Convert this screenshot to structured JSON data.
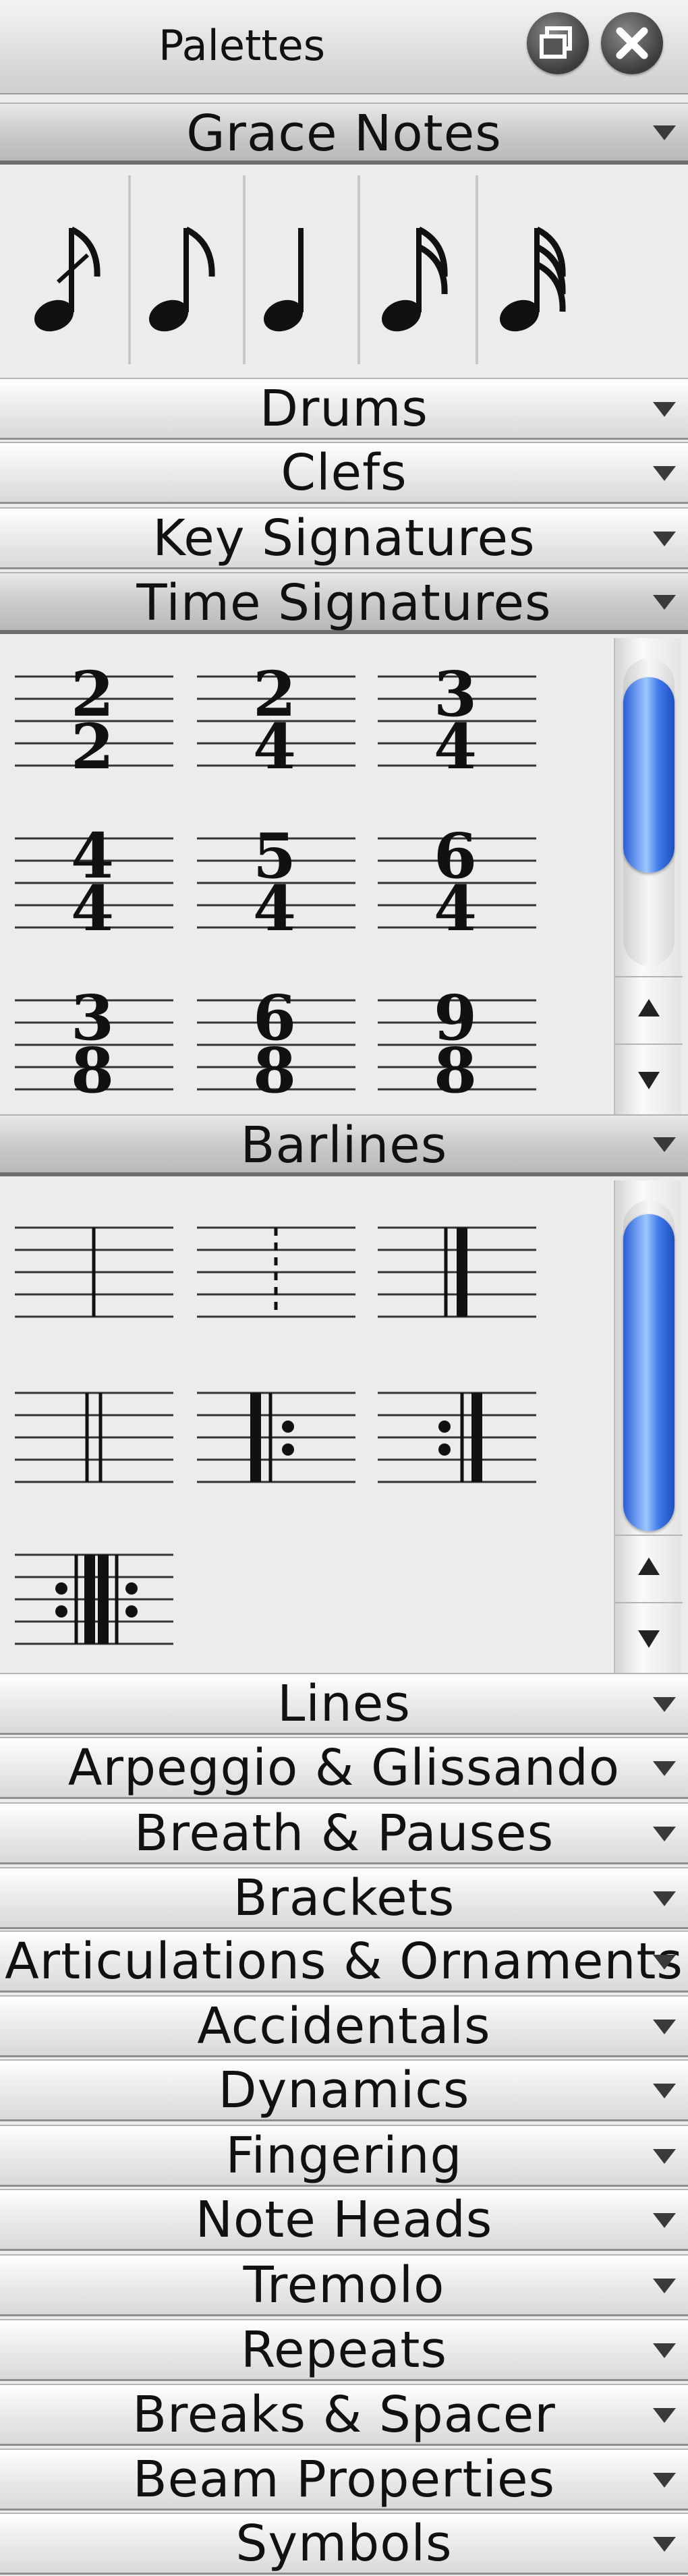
{
  "window": {
    "title": "Palettes",
    "buttons": {
      "restore": "restore-icon",
      "close": "close-icon"
    }
  },
  "sections": [
    {
      "label": "Grace Notes",
      "expanded": true
    },
    {
      "label": "Drums",
      "expanded": false
    },
    {
      "label": "Clefs",
      "expanded": false
    },
    {
      "label": "Key Signatures",
      "expanded": false
    },
    {
      "label": "Time Signatures",
      "expanded": true
    },
    {
      "label": "Barlines",
      "expanded": true
    },
    {
      "label": "Lines",
      "expanded": false
    },
    {
      "label": "Arpeggio & Glissando",
      "expanded": false
    },
    {
      "label": "Breath & Pauses",
      "expanded": false
    },
    {
      "label": "Brackets",
      "expanded": false
    },
    {
      "label": "Articulations & Ornaments",
      "expanded": false
    },
    {
      "label": "Accidentals",
      "expanded": false
    },
    {
      "label": "Dynamics",
      "expanded": false
    },
    {
      "label": "Fingering",
      "expanded": false
    },
    {
      "label": "Note Heads",
      "expanded": false
    },
    {
      "label": "Tremolo",
      "expanded": false
    },
    {
      "label": "Repeats",
      "expanded": false
    },
    {
      "label": "Breaks & Spacer",
      "expanded": false
    },
    {
      "label": "Beam Properties",
      "expanded": false
    },
    {
      "label": "Symbols",
      "expanded": false
    }
  ],
  "grace_notes": [
    {
      "icon": "acciaccatura-eighth-icon"
    },
    {
      "icon": "appoggiatura-eighth-icon"
    },
    {
      "icon": "quarter-grace-icon"
    },
    {
      "icon": "sixteenth-grace-icon"
    },
    {
      "icon": "thirty-second-grace-icon"
    }
  ],
  "time_signatures": [
    {
      "num": "2",
      "den": "2"
    },
    {
      "num": "2",
      "den": "4"
    },
    {
      "num": "3",
      "den": "4"
    },
    {
      "num": "4",
      "den": "4"
    },
    {
      "num": "5",
      "den": "4"
    },
    {
      "num": "6",
      "den": "4"
    },
    {
      "num": "3",
      "den": "8"
    },
    {
      "num": "6",
      "den": "8"
    },
    {
      "num": "9",
      "den": "8"
    }
  ],
  "barlines": [
    {
      "icon": "single-barline-icon",
      "type": "single"
    },
    {
      "icon": "dashed-barline-icon",
      "type": "dashed"
    },
    {
      "icon": "end-barline-icon",
      "type": "end"
    },
    {
      "icon": "double-barline-icon",
      "type": "double"
    },
    {
      "icon": "start-repeat-barline-icon",
      "type": "start-repeat"
    },
    {
      "icon": "end-repeat-barline-icon",
      "type": "end-repeat"
    },
    {
      "icon": "end-start-repeat-barline-icon",
      "type": "end-start-repeat"
    }
  ],
  "colors": {
    "scroll_thumb": "#3d78e8",
    "header": "#e0e0e0",
    "panel": "#ececec"
  }
}
